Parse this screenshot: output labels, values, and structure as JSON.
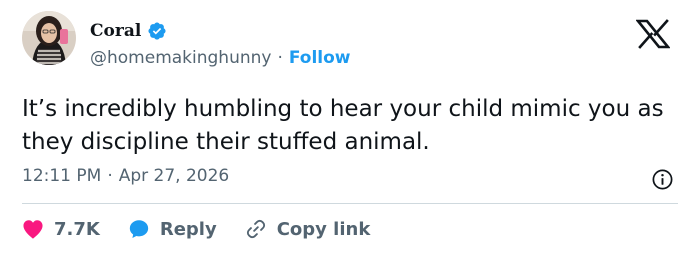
{
  "author": {
    "display_name": "Coral",
    "handle": "@homemakinghunny",
    "separator": "·",
    "follow_label": "Follow"
  },
  "tweet": {
    "text": "It’s incredibly humbling to hear your child mimic you as they discipline their stuffed animal."
  },
  "meta": {
    "time": "12:11 PM",
    "separator": "·",
    "date": "Apr 27, 2026"
  },
  "actions": {
    "like_count": "7.7K",
    "reply_label": "Reply",
    "copy_link_label": "Copy link"
  },
  "icons": {
    "verified": "verified-badge-icon",
    "platform": "x-logo-icon",
    "info": "info-icon",
    "like": "heart-icon",
    "reply": "speech-bubble-icon",
    "copy": "link-icon"
  },
  "colors": {
    "accent": "#1d9bf0",
    "like": "#f91880",
    "text": "#0f1419",
    "muted": "#536471"
  }
}
